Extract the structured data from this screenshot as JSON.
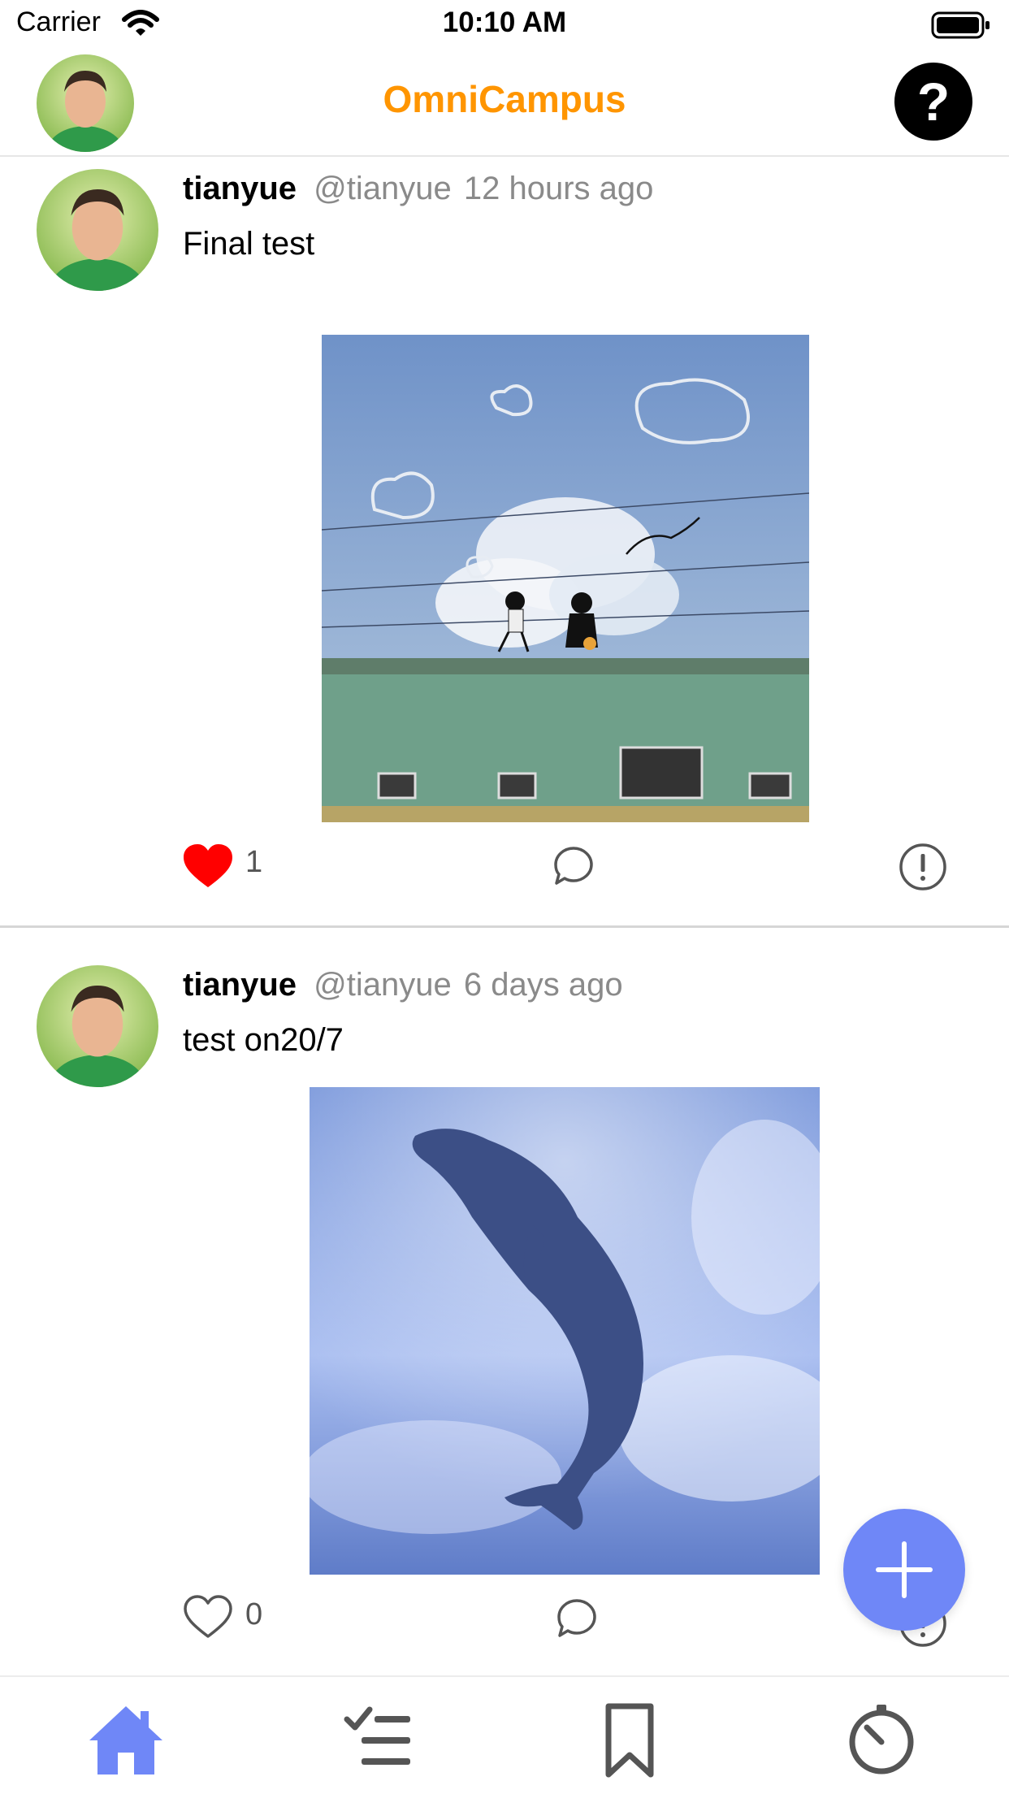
{
  "status_bar": {
    "carrier": "Carrier",
    "time": "10:10 AM"
  },
  "nav": {
    "title": "OmniCampus",
    "help_label": "?"
  },
  "posts": [
    {
      "username": "tianyue",
      "handle": "@tianyue",
      "time_ago": "12 hours ago",
      "text": "Final test",
      "likes": "1",
      "liked": true
    },
    {
      "username": "tianyue",
      "handle": "@tianyue",
      "time_ago": "6 days ago",
      "text": "test on20/7",
      "likes": "0",
      "liked": false
    }
  ],
  "colors": {
    "accent": "#ff9500",
    "fab": "#6f87f7",
    "tab_active": "#6f87f7",
    "tab_inactive": "#555555",
    "like": "#ff0000"
  },
  "tabs": [
    {
      "icon": "home-icon",
      "active": true
    },
    {
      "icon": "checklist-icon",
      "active": false
    },
    {
      "icon": "bookmark-icon",
      "active": false
    },
    {
      "icon": "timer-icon",
      "active": false
    }
  ]
}
